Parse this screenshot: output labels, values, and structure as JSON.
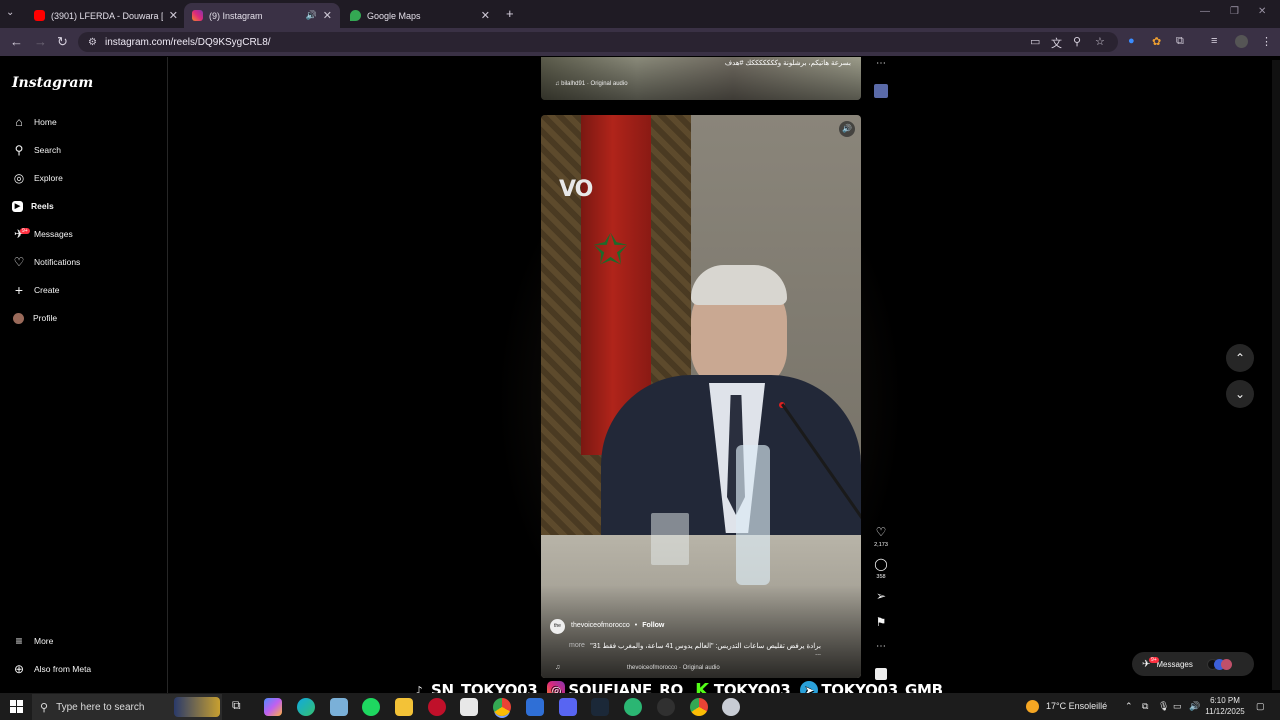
{
  "browser": {
    "tabs": [
      {
        "title": "(3901) LFERDA - Douwara [Clip",
        "active": false,
        "color": "#ff0000"
      },
      {
        "title": "(9) Instagram",
        "active": true,
        "color": "#e1306c"
      },
      {
        "title": "Google Maps",
        "active": false,
        "color": "#34a853"
      }
    ],
    "new_tab": "+",
    "url": "instagram.com/reels/DQ9KSygCRL8/"
  },
  "instagram": {
    "logo": "Instagram",
    "nav": [
      {
        "label": "Home",
        "icon": "home-icon",
        "glyph": "⌂"
      },
      {
        "label": "Search",
        "icon": "search-icon",
        "glyph": "⚲"
      },
      {
        "label": "Explore",
        "icon": "compass-icon",
        "glyph": "◎"
      },
      {
        "label": "Reels",
        "icon": "reels-icon",
        "glyph": "▶"
      },
      {
        "label": "Messages",
        "icon": "messenger-icon",
        "glyph": "✈",
        "badge": "9+"
      },
      {
        "label": "Notifications",
        "icon": "heart-icon",
        "glyph": "♡"
      },
      {
        "label": "Create",
        "icon": "plus-icon",
        "glyph": "+"
      },
      {
        "label": "Profile",
        "icon": "avatar-icon",
        "glyph": "●"
      }
    ],
    "more": "More",
    "also_from_meta": "Also from Meta"
  },
  "prev_reel": {
    "caption": "بسرعة هاتيكم، برشلونة وكككككككك #هدف",
    "audio": "bilalhd91 · Original audio"
  },
  "reel": {
    "watermark": "VO",
    "username": "thevoiceofmorocco",
    "follow": "Follow",
    "caption": "برادة يرفض تقليص ساعات التدريس: \"العالم يدوس 41 ساعة، والمغرب فقط 31\" ...",
    "more": "more",
    "audio": "thevoiceofmorocco · Original audio",
    "likes": "2,173",
    "comments": "358"
  },
  "messages_pill": {
    "label": "Messages",
    "badge": "9+"
  },
  "overlay": [
    {
      "platform": "tiktok",
      "handle": "SN_TOKYO03"
    },
    {
      "platform": "instagram",
      "handle": "SOUFIANE_RO"
    },
    {
      "platform": "kick",
      "handle": "TOKYO03"
    },
    {
      "platform": "telegram",
      "handle": "TOKYO03_GMB"
    }
  ],
  "taskbar": {
    "search_placeholder": "Type here to search",
    "weather": "17°C  Ensoleillé",
    "time": "6:10 PM",
    "date": "11/12/2025"
  },
  "colors": {
    "chrome_bg": "#1f1b24",
    "toolbar_bg": "#3a3145",
    "ig_bg": "#000000",
    "badge_red": "#ff3040",
    "taskbar_bg": "#1c1c1c"
  }
}
